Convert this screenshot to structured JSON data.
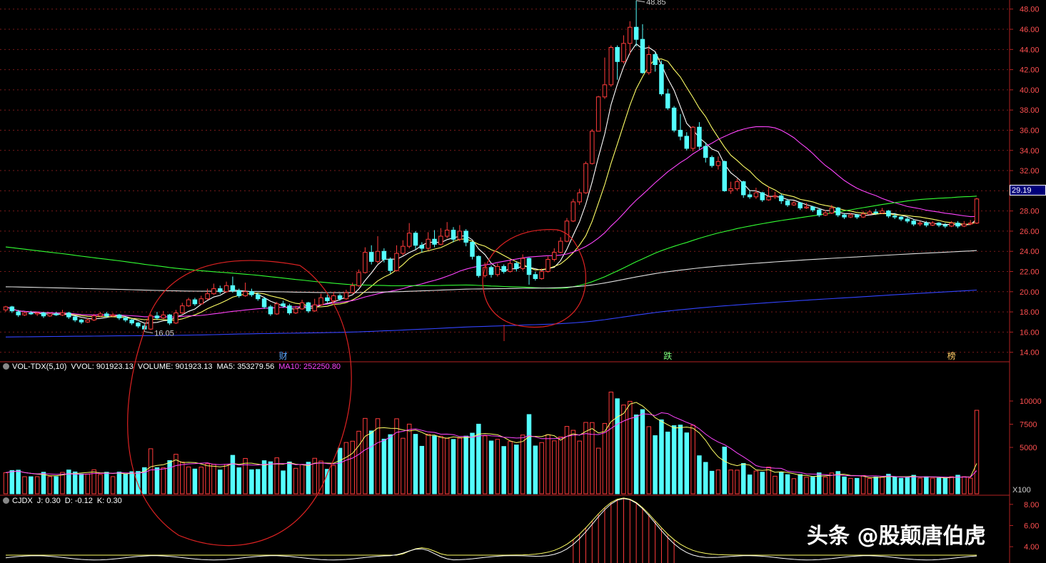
{
  "chart_data": [
    {
      "type": "candlestick",
      "panel": "price",
      "yticks": [
        "48.00",
        "46.00",
        "44.00",
        "42.00",
        "40.00",
        "38.00",
        "36.00",
        "34.00",
        "32.00",
        "30.00",
        "28.00",
        "26.00",
        "24.00",
        "22.00",
        "20.00",
        "18.00",
        "16.00",
        "14.00"
      ],
      "ylim": [
        13.2,
        48.9
      ],
      "current_price": "29.19",
      "annotations": {
        "high": "48.85",
        "low": "16.05"
      },
      "markers": [
        {
          "label": "财",
          "at_bar": 44,
          "color": "#5fa8ff"
        },
        {
          "label": "跌",
          "at_bar": 105,
          "color": "#7dff7d"
        },
        {
          "label": "榜",
          "at_bar": 150,
          "color": "#ffcc66"
        }
      ],
      "colors": {
        "up": "#ff3b3b",
        "down": "#54ffff",
        "ma5": "#ffffff",
        "ma10": "#ffff66",
        "ma20": "#ff44ff",
        "ma60": "#33ff33",
        "ma120": "#e0e0e0",
        "ma250": "#3344ff"
      },
      "candles": [
        {
          "o": 18.2,
          "c": 18.5,
          "h": 18.6,
          "l": 18.0
        },
        {
          "o": 18.5,
          "c": 18.1,
          "h": 18.6,
          "l": 17.9
        },
        {
          "o": 18.0,
          "c": 17.7,
          "h": 18.2,
          "l": 17.5
        },
        {
          "o": 17.7,
          "c": 17.9,
          "h": 18.0,
          "l": 17.6
        },
        {
          "o": 17.9,
          "c": 17.8,
          "h": 18.1,
          "l": 17.7
        },
        {
          "o": 17.8,
          "c": 17.9,
          "h": 18.0,
          "l": 17.6
        },
        {
          "o": 17.9,
          "c": 17.6,
          "h": 18.0,
          "l": 17.4
        },
        {
          "o": 17.6,
          "c": 17.8,
          "h": 17.9,
          "l": 17.5
        },
        {
          "o": 17.8,
          "c": 17.7,
          "h": 18.0,
          "l": 17.6
        },
        {
          "o": 17.7,
          "c": 17.9,
          "h": 18.2,
          "l": 17.6
        },
        {
          "o": 17.9,
          "c": 17.5,
          "h": 18.0,
          "l": 17.3
        },
        {
          "o": 17.5,
          "c": 17.2,
          "h": 17.6,
          "l": 17.0
        },
        {
          "o": 17.2,
          "c": 17.0,
          "h": 17.3,
          "l": 16.8
        },
        {
          "o": 17.0,
          "c": 17.2,
          "h": 17.4,
          "l": 16.9
        },
        {
          "o": 17.2,
          "c": 17.6,
          "h": 17.8,
          "l": 17.1
        },
        {
          "o": 17.6,
          "c": 17.8,
          "h": 18.0,
          "l": 17.5
        },
        {
          "o": 17.8,
          "c": 17.6,
          "h": 18.0,
          "l": 17.4
        },
        {
          "o": 17.6,
          "c": 17.7,
          "h": 17.9,
          "l": 17.5
        },
        {
          "o": 17.7,
          "c": 17.4,
          "h": 17.8,
          "l": 17.2
        },
        {
          "o": 17.4,
          "c": 17.2,
          "h": 17.5,
          "l": 17.0
        },
        {
          "o": 17.2,
          "c": 16.9,
          "h": 17.3,
          "l": 16.7
        },
        {
          "o": 16.9,
          "c": 16.6,
          "h": 17.0,
          "l": 16.4
        },
        {
          "o": 16.6,
          "c": 16.3,
          "h": 16.8,
          "l": 16.05
        },
        {
          "o": 16.3,
          "c": 17.6,
          "h": 17.8,
          "l": 16.2
        },
        {
          "o": 17.6,
          "c": 17.4,
          "h": 18.0,
          "l": 17.2
        },
        {
          "o": 17.4,
          "c": 17.7,
          "h": 18.1,
          "l": 17.3
        },
        {
          "o": 17.7,
          "c": 16.9,
          "h": 17.8,
          "l": 16.7
        },
        {
          "o": 16.9,
          "c": 17.9,
          "h": 18.2,
          "l": 16.8
        },
        {
          "o": 17.9,
          "c": 18.6,
          "h": 18.9,
          "l": 17.8
        },
        {
          "o": 18.6,
          "c": 19.2,
          "h": 19.4,
          "l": 18.5
        },
        {
          "o": 19.2,
          "c": 18.8,
          "h": 19.4,
          "l": 18.6
        },
        {
          "o": 18.8,
          "c": 19.3,
          "h": 19.6,
          "l": 18.7
        },
        {
          "o": 19.3,
          "c": 19.8,
          "h": 20.3,
          "l": 19.2
        },
        {
          "o": 19.8,
          "c": 20.3,
          "h": 20.8,
          "l": 19.7
        },
        {
          "o": 20.3,
          "c": 20.0,
          "h": 20.6,
          "l": 19.8
        },
        {
          "o": 20.0,
          "c": 20.6,
          "h": 21.0,
          "l": 19.9
        },
        {
          "o": 20.6,
          "c": 20.1,
          "h": 21.5,
          "l": 19.9
        },
        {
          "o": 20.1,
          "c": 19.6,
          "h": 20.3,
          "l": 19.4
        },
        {
          "o": 19.6,
          "c": 20.0,
          "h": 20.9,
          "l": 19.5
        },
        {
          "o": 20.0,
          "c": 19.7,
          "h": 20.3,
          "l": 19.5
        },
        {
          "o": 19.7,
          "c": 19.3,
          "h": 19.9,
          "l": 19.1
        },
        {
          "o": 19.3,
          "c": 18.5,
          "h": 19.5,
          "l": 18.3
        },
        {
          "o": 18.5,
          "c": 17.8,
          "h": 18.7,
          "l": 17.6
        },
        {
          "o": 17.8,
          "c": 18.8,
          "h": 19.0,
          "l": 17.7
        },
        {
          "o": 18.8,
          "c": 18.6,
          "h": 19.1,
          "l": 18.4
        },
        {
          "o": 18.6,
          "c": 17.9,
          "h": 18.8,
          "l": 17.7
        },
        {
          "o": 17.9,
          "c": 18.3,
          "h": 18.6,
          "l": 17.8
        },
        {
          "o": 18.3,
          "c": 18.9,
          "h": 19.2,
          "l": 18.2
        },
        {
          "o": 18.9,
          "c": 18.1,
          "h": 19.0,
          "l": 17.9
        },
        {
          "o": 18.1,
          "c": 18.7,
          "h": 19.3,
          "l": 18.0
        },
        {
          "o": 18.7,
          "c": 19.4,
          "h": 19.8,
          "l": 18.6
        },
        {
          "o": 19.4,
          "c": 19.1,
          "h": 19.7,
          "l": 18.9
        },
        {
          "o": 19.1,
          "c": 19.6,
          "h": 20.0,
          "l": 19.0
        },
        {
          "o": 19.6,
          "c": 19.3,
          "h": 19.8,
          "l": 19.1
        },
        {
          "o": 19.3,
          "c": 19.9,
          "h": 20.2,
          "l": 19.2
        },
        {
          "o": 19.9,
          "c": 20.6,
          "h": 20.9,
          "l": 19.8
        },
        {
          "o": 20.6,
          "c": 21.9,
          "h": 22.2,
          "l": 20.5
        },
        {
          "o": 21.9,
          "c": 23.9,
          "h": 24.4,
          "l": 21.8
        },
        {
          "o": 23.9,
          "c": 23.0,
          "h": 24.6,
          "l": 22.7
        },
        {
          "o": 23.0,
          "c": 24.0,
          "h": 25.5,
          "l": 22.8
        },
        {
          "o": 24.0,
          "c": 23.2,
          "h": 24.3,
          "l": 22.9
        },
        {
          "o": 23.2,
          "c": 22.1,
          "h": 23.4,
          "l": 21.8
        },
        {
          "o": 22.1,
          "c": 23.8,
          "h": 24.6,
          "l": 22.0
        },
        {
          "o": 23.8,
          "c": 24.5,
          "h": 25.1,
          "l": 23.6
        },
        {
          "o": 24.5,
          "c": 25.8,
          "h": 26.8,
          "l": 24.3
        },
        {
          "o": 25.8,
          "c": 24.6,
          "h": 26.0,
          "l": 24.2
        },
        {
          "o": 24.6,
          "c": 24.3,
          "h": 24.9,
          "l": 23.9
        },
        {
          "o": 24.3,
          "c": 25.2,
          "h": 25.9,
          "l": 24.1
        },
        {
          "o": 25.2,
          "c": 24.7,
          "h": 26.1,
          "l": 24.4
        },
        {
          "o": 24.7,
          "c": 25.5,
          "h": 26.3,
          "l": 24.6
        },
        {
          "o": 25.5,
          "c": 26.1,
          "h": 26.9,
          "l": 25.3
        },
        {
          "o": 26.1,
          "c": 25.2,
          "h": 26.4,
          "l": 24.9
        },
        {
          "o": 25.2,
          "c": 26.0,
          "h": 26.6,
          "l": 25.0
        },
        {
          "o": 26.0,
          "c": 24.9,
          "h": 26.2,
          "l": 24.5
        },
        {
          "o": 24.9,
          "c": 23.5,
          "h": 25.0,
          "l": 23.2
        },
        {
          "o": 23.5,
          "c": 21.6,
          "h": 23.6,
          "l": 21.4
        },
        {
          "o": 21.6,
          "c": 22.4,
          "h": 22.9,
          "l": 21.4
        },
        {
          "o": 22.4,
          "c": 21.7,
          "h": 22.6,
          "l": 21.4
        },
        {
          "o": 21.7,
          "c": 22.5,
          "h": 22.8,
          "l": 21.5
        },
        {
          "o": 22.5,
          "c": 22.0,
          "h": 22.7,
          "l": 21.8
        },
        {
          "o": 22.0,
          "c": 22.8,
          "h": 23.1,
          "l": 21.9
        },
        {
          "o": 22.8,
          "c": 22.3,
          "h": 23.0,
          "l": 22.0
        },
        {
          "o": 22.3,
          "c": 23.3,
          "h": 23.7,
          "l": 22.1
        },
        {
          "o": 23.3,
          "c": 21.7,
          "h": 23.4,
          "l": 20.7
        },
        {
          "o": 21.7,
          "c": 21.3,
          "h": 22.0,
          "l": 21.1
        },
        {
          "o": 21.3,
          "c": 22.0,
          "h": 22.3,
          "l": 21.2
        },
        {
          "o": 22.0,
          "c": 23.2,
          "h": 23.5,
          "l": 21.9
        },
        {
          "o": 23.2,
          "c": 23.9,
          "h": 24.3,
          "l": 23.0
        },
        {
          "o": 23.9,
          "c": 25.0,
          "h": 25.4,
          "l": 23.8
        },
        {
          "o": 25.0,
          "c": 27.0,
          "h": 27.3,
          "l": 24.9
        },
        {
          "o": 27.0,
          "c": 28.9,
          "h": 29.2,
          "l": 26.9
        },
        {
          "o": 28.9,
          "c": 29.8,
          "h": 30.2,
          "l": 28.6
        },
        {
          "o": 29.8,
          "c": 32.7,
          "h": 32.9,
          "l": 29.7
        },
        {
          "o": 32.7,
          "c": 35.9,
          "h": 36.1,
          "l": 32.6
        },
        {
          "o": 35.9,
          "c": 39.3,
          "h": 39.4,
          "l": 38.0
        },
        {
          "o": 39.3,
          "c": 40.5,
          "h": 43.2,
          "l": 39.1
        },
        {
          "o": 40.5,
          "c": 44.2,
          "h": 44.4,
          "l": 40.3
        },
        {
          "o": 44.2,
          "c": 42.8,
          "h": 44.4,
          "l": 41.0
        },
        {
          "o": 42.8,
          "c": 44.6,
          "h": 45.4,
          "l": 42.6
        },
        {
          "o": 44.6,
          "c": 46.2,
          "h": 46.8,
          "l": 43.5
        },
        {
          "o": 46.2,
          "c": 45.0,
          "h": 48.85,
          "l": 44.3
        },
        {
          "o": 45.0,
          "c": 41.7,
          "h": 46.5,
          "l": 41.6
        },
        {
          "o": 41.7,
          "c": 43.5,
          "h": 44.4,
          "l": 41.5
        },
        {
          "o": 43.5,
          "c": 42.5,
          "h": 43.7,
          "l": 41.8
        },
        {
          "o": 42.5,
          "c": 39.6,
          "h": 42.9,
          "l": 39.4
        },
        {
          "o": 39.6,
          "c": 38.2,
          "h": 40.1,
          "l": 38.0
        },
        {
          "o": 38.2,
          "c": 36.0,
          "h": 38.4,
          "l": 35.8
        },
        {
          "o": 36.0,
          "c": 35.4,
          "h": 37.6,
          "l": 35.0
        },
        {
          "o": 35.4,
          "c": 34.2,
          "h": 35.8,
          "l": 34.0
        },
        {
          "o": 34.2,
          "c": 36.3,
          "h": 36.4,
          "l": 33.9
        },
        {
          "o": 36.3,
          "c": 34.4,
          "h": 36.8,
          "l": 34.1
        },
        {
          "o": 34.4,
          "c": 33.3,
          "h": 34.8,
          "l": 32.8
        },
        {
          "o": 33.3,
          "c": 32.5,
          "h": 33.5,
          "l": 32.3
        },
        {
          "o": 32.5,
          "c": 32.9,
          "h": 33.4,
          "l": 32.1
        },
        {
          "o": 32.9,
          "c": 30.0,
          "h": 33.0,
          "l": 29.9
        },
        {
          "o": 30.0,
          "c": 30.2,
          "h": 30.9,
          "l": 29.7
        },
        {
          "o": 30.2,
          "c": 30.9,
          "h": 31.2,
          "l": 30.0
        },
        {
          "o": 30.9,
          "c": 29.6,
          "h": 31.0,
          "l": 29.3
        },
        {
          "o": 29.6,
          "c": 29.4,
          "h": 30.0,
          "l": 29.2
        },
        {
          "o": 29.4,
          "c": 29.8,
          "h": 30.3,
          "l": 29.2
        },
        {
          "o": 29.8,
          "c": 29.1,
          "h": 29.9,
          "l": 28.9
        },
        {
          "o": 29.1,
          "c": 29.4,
          "h": 30.4,
          "l": 29.0
        },
        {
          "o": 29.4,
          "c": 29.5,
          "h": 29.9,
          "l": 29.2
        },
        {
          "o": 29.5,
          "c": 29.0,
          "h": 29.7,
          "l": 28.7
        },
        {
          "o": 29.0,
          "c": 28.6,
          "h": 29.2,
          "l": 28.4
        },
        {
          "o": 28.6,
          "c": 28.8,
          "h": 29.0,
          "l": 28.5
        },
        {
          "o": 28.8,
          "c": 28.3,
          "h": 28.9,
          "l": 28.1
        },
        {
          "o": 28.3,
          "c": 28.4,
          "h": 28.8,
          "l": 28.2
        },
        {
          "o": 28.4,
          "c": 28.1,
          "h": 28.5,
          "l": 27.9
        },
        {
          "o": 28.1,
          "c": 27.6,
          "h": 28.3,
          "l": 27.4
        },
        {
          "o": 27.6,
          "c": 27.8,
          "h": 28.1,
          "l": 27.5
        },
        {
          "o": 27.8,
          "c": 28.3,
          "h": 28.6,
          "l": 27.7
        },
        {
          "o": 28.3,
          "c": 27.6,
          "h": 28.4,
          "l": 27.4
        },
        {
          "o": 27.6,
          "c": 27.4,
          "h": 27.8,
          "l": 27.2
        },
        {
          "o": 27.4,
          "c": 27.6,
          "h": 27.8,
          "l": 27.3
        },
        {
          "o": 27.6,
          "c": 27.4,
          "h": 27.7,
          "l": 27.2
        },
        {
          "o": 27.4,
          "c": 27.7,
          "h": 28.0,
          "l": 27.3
        },
        {
          "o": 27.7,
          "c": 27.9,
          "h": 28.1,
          "l": 27.6
        },
        {
          "o": 27.9,
          "c": 27.8,
          "h": 28.2,
          "l": 27.6
        },
        {
          "o": 27.8,
          "c": 28.0,
          "h": 28.3,
          "l": 27.7
        },
        {
          "o": 28.0,
          "c": 27.5,
          "h": 28.1,
          "l": 27.3
        },
        {
          "o": 27.5,
          "c": 27.4,
          "h": 27.8,
          "l": 27.2
        },
        {
          "o": 27.4,
          "c": 27.2,
          "h": 27.5,
          "l": 27.0
        },
        {
          "o": 27.2,
          "c": 27.0,
          "h": 27.4,
          "l": 26.8
        },
        {
          "o": 27.0,
          "c": 26.7,
          "h": 27.2,
          "l": 26.5
        },
        {
          "o": 26.7,
          "c": 26.8,
          "h": 27.0,
          "l": 26.5
        },
        {
          "o": 26.8,
          "c": 26.6,
          "h": 27.0,
          "l": 26.4
        },
        {
          "o": 26.6,
          "c": 26.8,
          "h": 27.0,
          "l": 26.5
        },
        {
          "o": 26.8,
          "c": 26.6,
          "h": 26.9,
          "l": 26.4
        },
        {
          "o": 26.6,
          "c": 26.5,
          "h": 26.8,
          "l": 26.3
        },
        {
          "o": 26.5,
          "c": 26.8,
          "h": 27.0,
          "l": 26.4
        },
        {
          "o": 26.8,
          "c": 26.5,
          "h": 27.0,
          "l": 26.3
        },
        {
          "o": 26.5,
          "c": 26.7,
          "h": 27.0,
          "l": 26.4
        },
        {
          "o": 26.7,
          "c": 26.8,
          "h": 27.1,
          "l": 26.6
        },
        {
          "o": 26.8,
          "c": 29.19,
          "h": 29.3,
          "l": 26.7
        }
      ]
    },
    {
      "type": "bar",
      "panel": "volume",
      "yticks": [
        "10000",
        "7500",
        "5000"
      ],
      "ylim": [
        0,
        14000
      ],
      "scale_label": "X100",
      "legend": {
        "name": "VOL-TDX(5,10)",
        "vvol": "VVOL: 901923.13",
        "volume": "VOLUME: 901923.13",
        "ma5": "MA5: 353279.56",
        "ma10": "MA10: 252250.80"
      },
      "colors": {
        "ma5": "#ffff66",
        "ma10": "#ff44ff",
        "label": "#ffffff"
      }
    },
    {
      "type": "line",
      "panel": "indicator",
      "yticks": [
        "8.00",
        "6.00",
        "4.00"
      ],
      "ylim": [
        3.0,
        9.0
      ],
      "legend": {
        "name": "CJDX",
        "j": "J: 0.30",
        "d": "D: -0.12",
        "k": "K: 0.30"
      }
    }
  ],
  "watermark": "头条 @股颠唐伯虎"
}
